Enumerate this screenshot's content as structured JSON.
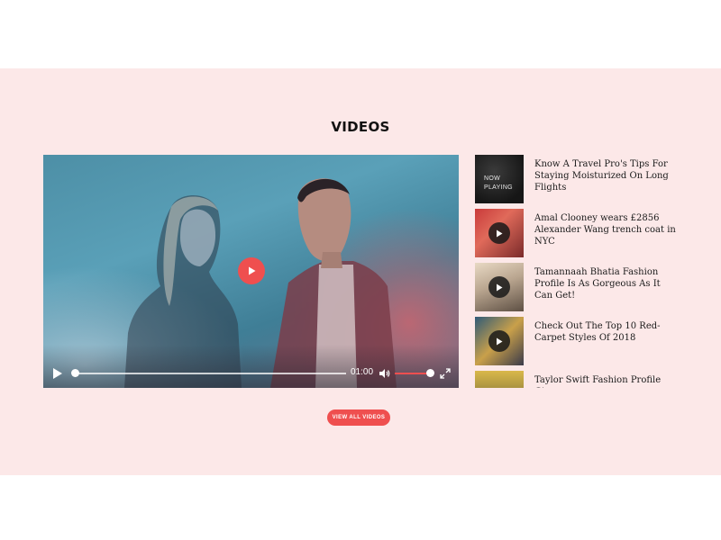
{
  "section": {
    "title": "VIDEOS"
  },
  "player": {
    "current_time": "01:00",
    "volume_percent": 88,
    "progress_percent": 0
  },
  "playlist": [
    {
      "title": "Know A Travel Pro's Tips For Staying Moisturized On Long Flights",
      "status": "NOW PLAYING"
    },
    {
      "title": "Amal Clooney wears £2856 Alexander Wang trench coat in NYC"
    },
    {
      "title": "Tamannaah Bhatia Fashion Profile Is As Gorgeous As It Can Get!"
    },
    {
      "title": "Check Out The Top 10 Red-Carpet Styles Of 2018"
    },
    {
      "title": "Taylor Swift Fashion Profile Gives"
    }
  ],
  "actions": {
    "view_all_label": "VIEW ALL VIDEOS"
  },
  "colors": {
    "accent": "#ef4f4f",
    "band_background": "#fce8e8"
  },
  "icons": [
    "play-icon",
    "volume-icon",
    "fullscreen-icon"
  ]
}
